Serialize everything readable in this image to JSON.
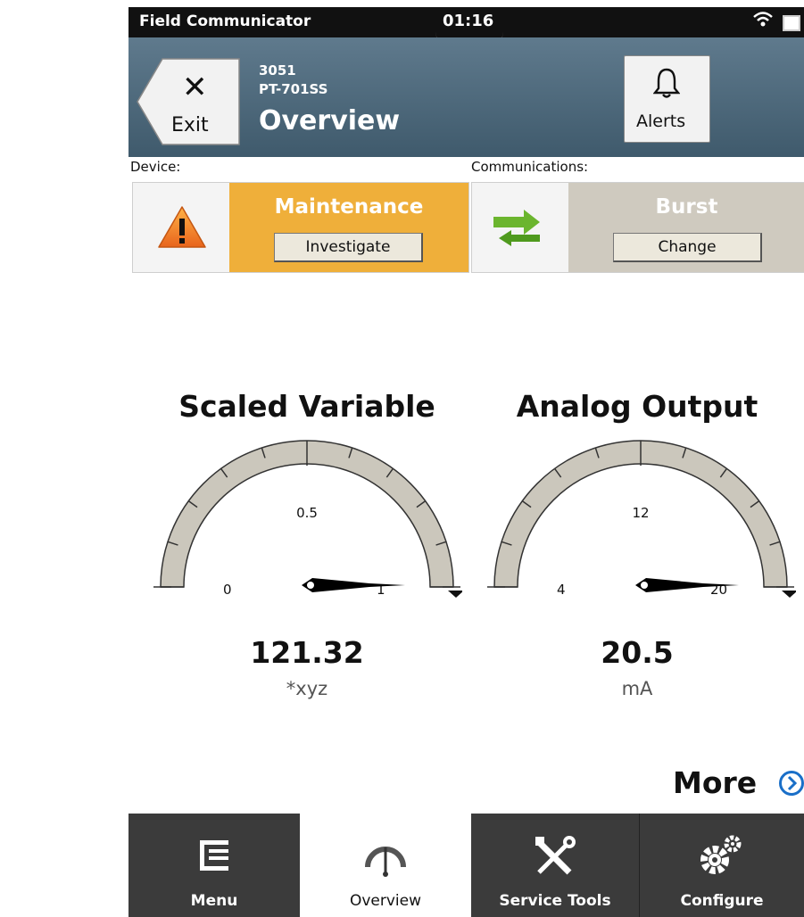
{
  "status_bar": {
    "app_name": "Field Communicator",
    "time": "01:16",
    "wifi_icon": "wifi-icon",
    "battery_icon": "battery-icon"
  },
  "header": {
    "exit_label": "Exit",
    "device_model": "3051",
    "device_tag": "PT-701SS",
    "title": "Overview",
    "alerts_label": "Alerts"
  },
  "device_status": {
    "section_label": "Device:",
    "state": "Maintenance",
    "button_label": "Investigate",
    "color": "#efaf3a",
    "icon": "warning-icon"
  },
  "communications": {
    "section_label": "Communications:",
    "state": "Burst",
    "button_label": "Change",
    "color": "#cfcabf",
    "icon": "burst-arrows-icon"
  },
  "gauges": [
    {
      "title": "Scaled Variable",
      "min_label": "0",
      "mid_label": "0.5",
      "max_label": "1",
      "min": 0,
      "max": 1,
      "needle_fraction": 1.0,
      "value": "121.32",
      "unit": "*xyz"
    },
    {
      "title": "Analog Output",
      "min_label": "4",
      "mid_label": "12",
      "max_label": "20",
      "min": 4,
      "max": 20,
      "needle_fraction": 1.0,
      "value": "20.5",
      "unit": "mA"
    }
  ],
  "more_label": "More",
  "nav": [
    {
      "label": "Menu",
      "icon": "menu-list-icon",
      "active": false
    },
    {
      "label": "Overview",
      "icon": "gauge-icon",
      "active": true
    },
    {
      "label": "Service Tools",
      "icon": "tools-icon",
      "active": false
    },
    {
      "label": "Configure",
      "icon": "gears-icon",
      "active": false
    }
  ]
}
